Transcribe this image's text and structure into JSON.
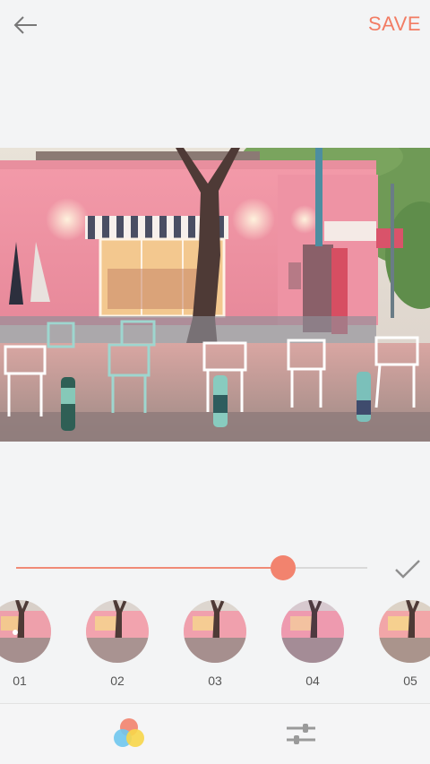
{
  "header": {
    "back_icon": "arrow-left-icon",
    "save_label": "SAVE"
  },
  "editor": {
    "intensity_fraction": 0.76,
    "confirm_icon": "checkmark-icon"
  },
  "filters": [
    {
      "label": "01"
    },
    {
      "label": "02"
    },
    {
      "label": "03"
    },
    {
      "label": "04"
    },
    {
      "label": "05"
    }
  ],
  "bottom_tabs": [
    {
      "icon": "filter-circles-icon",
      "active": true
    },
    {
      "icon": "adjust-sliders-icon",
      "active": false
    }
  ],
  "colors": {
    "accent": "#f27c63",
    "background": "#f3f4f5",
    "track": "#d9d9d9"
  }
}
